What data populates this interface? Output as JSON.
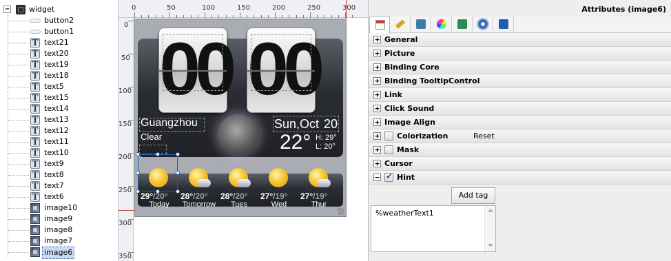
{
  "tree": {
    "root_label": "widget",
    "items": [
      {
        "label": "button2",
        "icon": "button-icon"
      },
      {
        "label": "button1",
        "icon": "button-icon"
      },
      {
        "label": "text21",
        "icon": "text-icon"
      },
      {
        "label": "text20",
        "icon": "text-icon"
      },
      {
        "label": "text19",
        "icon": "text-icon"
      },
      {
        "label": "text18",
        "icon": "text-icon"
      },
      {
        "label": "text5",
        "icon": "text-icon"
      },
      {
        "label": "text15",
        "icon": "text-icon"
      },
      {
        "label": "text14",
        "icon": "text-icon"
      },
      {
        "label": "text13",
        "icon": "text-icon"
      },
      {
        "label": "text12",
        "icon": "text-icon"
      },
      {
        "label": "text11",
        "icon": "text-icon"
      },
      {
        "label": "text10",
        "icon": "text-icon"
      },
      {
        "label": "text9",
        "icon": "text-icon"
      },
      {
        "label": "text8",
        "icon": "text-icon"
      },
      {
        "label": "text7",
        "icon": "text-icon"
      },
      {
        "label": "text6",
        "icon": "text-icon"
      },
      {
        "label": "image10",
        "icon": "image-icon"
      },
      {
        "label": "image9",
        "icon": "image-icon"
      },
      {
        "label": "image8",
        "icon": "image-icon"
      },
      {
        "label": "image7",
        "icon": "image-icon"
      },
      {
        "label": "image6",
        "icon": "image-icon",
        "selected": true
      }
    ]
  },
  "ruler": {
    "h_labels": [
      "0",
      "50",
      "100",
      "150",
      "200",
      "250",
      "300"
    ],
    "v_labels": [
      "0",
      "50",
      "100",
      "150",
      "200",
      "250",
      "300",
      "350"
    ]
  },
  "widget": {
    "hour": "00",
    "minute": "00",
    "city": "Guangzhou",
    "condition": "Clear",
    "date": "Sun,Oct",
    "day_num": "20",
    "current_temp": "22°",
    "high": "H: 29°",
    "low": "L: 20°",
    "forecast": [
      {
        "day": "Today",
        "high": "29°",
        "low": "20°",
        "icon": "sun-icon"
      },
      {
        "day": "Tomorrow",
        "high": "28°",
        "low": "20°",
        "icon": "partly-cloudy-icon"
      },
      {
        "day": "Tues",
        "high": "28°",
        "low": "20°",
        "icon": "partly-cloudy-icon"
      },
      {
        "day": "Wed",
        "high": "27°",
        "low": "19°",
        "icon": "sun-icon"
      },
      {
        "day": "Thur",
        "high": "27°",
        "low": "19°",
        "icon": "partly-cloudy-icon"
      }
    ]
  },
  "attributes": {
    "title": "Attributes (image6)",
    "tabs": [
      "calendar-icon",
      "ruler-icon",
      "shapes-icon",
      "color-wheel-icon",
      "cube-icon",
      "gear-icon",
      "box-icon"
    ],
    "sections": [
      {
        "label": "General",
        "expanded": false
      },
      {
        "label": "Picture",
        "expanded": false
      },
      {
        "label": "Binding Core",
        "expanded": false
      },
      {
        "label": "Binding TooltipControl",
        "expanded": false
      },
      {
        "label": "Link",
        "expanded": false
      },
      {
        "label": "Click Sound",
        "expanded": false
      },
      {
        "label": "Image Align",
        "expanded": false
      },
      {
        "label": "Colorization",
        "expanded": false,
        "checkbox": false,
        "extra": "Reset"
      },
      {
        "label": "Mask",
        "expanded": false,
        "checkbox": false
      },
      {
        "label": "Cursor",
        "expanded": false
      },
      {
        "label": "Hint",
        "expanded": true,
        "checkbox": true
      }
    ],
    "add_tag_label": "Add tag",
    "hint_value": "%weatherText1"
  },
  "colors": {
    "accent": "#1a5fb4",
    "selection": "#c9dcf2",
    "ruler_guide": "#d03030"
  }
}
